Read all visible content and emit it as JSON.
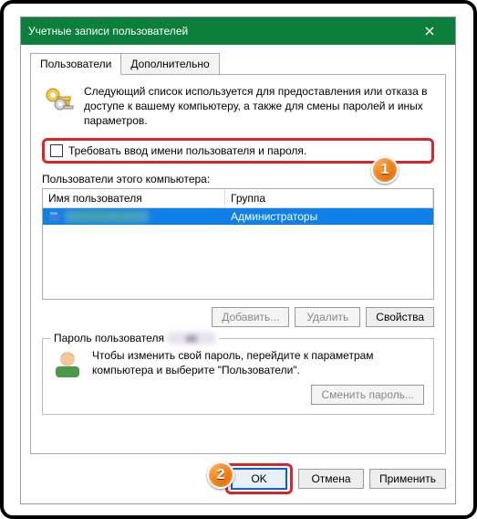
{
  "title": "Учетные записи пользователей",
  "tabs": {
    "users": "Пользователи",
    "advanced": "Дополнительно"
  },
  "intro": "Следующий список используется для предоставления или отказа в доступе к вашему компьютеру, а также для смены паролей и иных параметров.",
  "require_cred_label": "Требовать ввод имени пользователя и пароля.",
  "users_of_computer": "Пользователи этого компьютера:",
  "columns": {
    "user": "Имя пользователя",
    "group": "Группа"
  },
  "row": {
    "user_blurred": "user@mail.ru",
    "group": "Администраторы"
  },
  "buttons": {
    "add": "Добавить...",
    "remove": "Удалить",
    "props": "Свойства",
    "change_pwd": "Сменить пароль...",
    "ok": "OK",
    "cancel": "Отмена",
    "apply": "Применить"
  },
  "pwd_group_label": "Пароль пользователя",
  "pwd_text": "Чтобы изменить свой пароль, перейдите к параметрам компьютера и выберите \"Пользователи\".",
  "badges": {
    "one": "1",
    "two": "2"
  }
}
